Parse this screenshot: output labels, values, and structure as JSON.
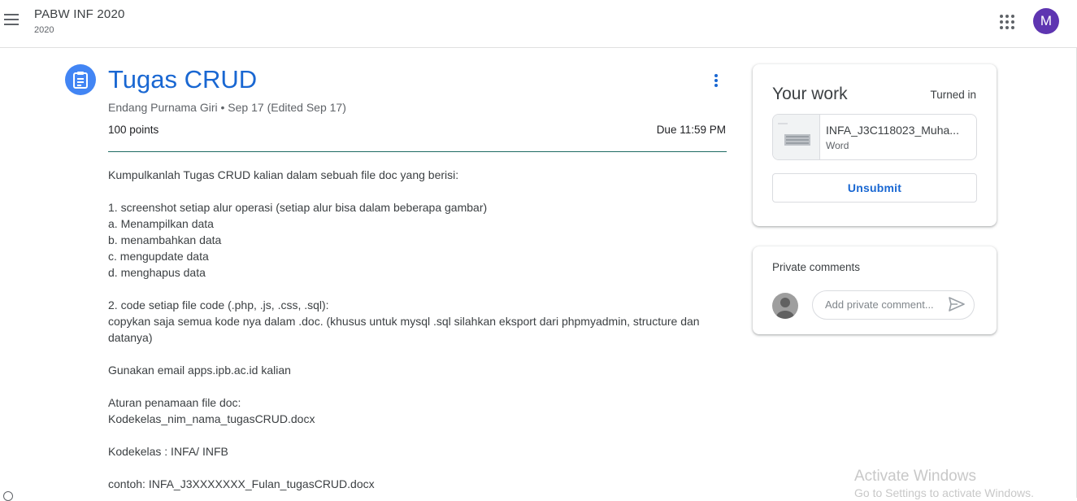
{
  "header": {
    "class_name": "PABW INF 2020",
    "class_section": "2020",
    "account_initial": "M",
    "menu_icon": "hamburger-menu-icon",
    "apps_icon": "google-apps-icon"
  },
  "assignment": {
    "icon": "assignment-icon",
    "title": "Tugas CRUD",
    "meta": "Endang Purnama Giri • Sep 17 (Edited Sep 17)",
    "points": "100 points",
    "due": "Due 11:59 PM",
    "description": [
      "Kumpulkanlah Tugas CRUD kalian dalam sebuah file doc yang berisi:",
      "",
      "1. screenshot setiap alur operasi (setiap alur bisa dalam beberapa gambar)",
      "a. Menampilkan data",
      "b. menambahkan data",
      "c. mengupdate data",
      "d. menghapus data",
      "",
      "2. code setiap file code (.php, .js, .css, .sql):",
      "copykan saja semua kode nya dalam .doc. (khusus untuk mysql .sql silahkan eksport dari phpmyadmin, structure dan datanya)",
      "",
      "Gunakan email apps.ipb.ac.id kalian",
      "",
      "Aturan penamaan file doc:",
      "Kodekelas_nim_nama_tugasCRUD.docx",
      "",
      "Kodekelas : INFA/ INFB",
      "",
      "contoh: INFA_J3XXXXXXX_Fulan_tugasCRUD.docx"
    ]
  },
  "your_work": {
    "title": "Your work",
    "status": "Turned in",
    "file_name": "INFA_J3C118023_Muha...",
    "file_type": "Word",
    "unsubmit_label": "Unsubmit"
  },
  "private_comments": {
    "title": "Private comments",
    "input_placeholder": "Add private comment...",
    "send_icon": "send-icon"
  },
  "watermark": {
    "line1": "Activate Windows",
    "line2": "Go to Settings to activate Windows."
  },
  "colors": {
    "accent": "#1967d2",
    "assignment_icon_bg": "#4285f4",
    "avatar_bg": "#5e35b1",
    "divider": "#1e6b63"
  }
}
